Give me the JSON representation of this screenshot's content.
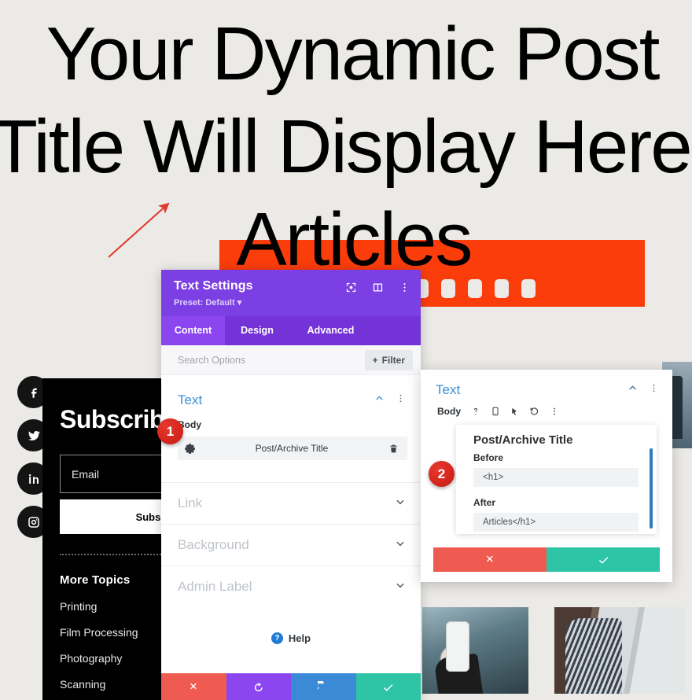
{
  "page": {
    "hero_lines": [
      "Your Dynamic Post",
      "Title Will Display Here",
      "Articles"
    ],
    "hero_full_text": "Your Dynamic Post Title Will Display Here Articles",
    "colors": {
      "background": "#eceae6",
      "film_orange": "#fb3d0c",
      "accent_purple": "#7b3fe4",
      "link_blue": "#3b8fd4",
      "badge_red": "#c51a12"
    }
  },
  "social": {
    "items": [
      {
        "name": "facebook",
        "glyph": "f"
      },
      {
        "name": "twitter",
        "glyph": "t"
      },
      {
        "name": "linkedin",
        "glyph": "in"
      },
      {
        "name": "instagram",
        "glyph": "ig"
      }
    ]
  },
  "subscribe": {
    "title": "Subscribe",
    "email_placeholder": "Email",
    "button_label": "Subscribe",
    "more_topics_heading": "More Topics",
    "topics": [
      "Printing",
      "Film Processing",
      "Photography",
      "Scanning"
    ]
  },
  "settings_panel": {
    "title": "Text Settings",
    "preset": "Preset: Default",
    "header_icons": [
      "fullscreen-icon",
      "layout-icon",
      "more-vertical-icon"
    ],
    "tabs": [
      {
        "label": "Content",
        "active": true
      },
      {
        "label": "Design",
        "active": false
      },
      {
        "label": "Advanced",
        "active": false
      }
    ],
    "search_placeholder": "Search Options",
    "filter_label": "Filter",
    "text_section": {
      "title": "Text",
      "field_label": "Body",
      "dynamic_value": "Post/Archive Title"
    },
    "collapsed_sections": [
      "Link",
      "Background",
      "Admin Label"
    ],
    "help_label": "Help",
    "footer_buttons": [
      {
        "name": "cancel",
        "glyph": "✖"
      },
      {
        "name": "undo",
        "glyph": "↺"
      },
      {
        "name": "redo",
        "glyph": "↻"
      },
      {
        "name": "save",
        "glyph": "✔"
      }
    ]
  },
  "dynamic_popup": {
    "title": "Text",
    "toolbar_label": "Body",
    "toolbar_icons": [
      "help-icon",
      "responsive-icon",
      "hover-icon",
      "reset-icon",
      "more-vertical-icon"
    ],
    "card_title": "Post/Archive Title",
    "before_label": "Before",
    "before_value": "<h1>",
    "after_label": "After",
    "after_value": "Articles</h1>",
    "footer_buttons": [
      {
        "name": "cancel",
        "glyph": "✖"
      },
      {
        "name": "save",
        "glyph": "✔"
      }
    ]
  },
  "background_labels": {
    "admin_label_ghost": "Admin Label"
  },
  "annotations": {
    "badges": [
      {
        "number": "1"
      },
      {
        "number": "2"
      }
    ],
    "arrow": "red-arrow-pointing-up-right"
  }
}
